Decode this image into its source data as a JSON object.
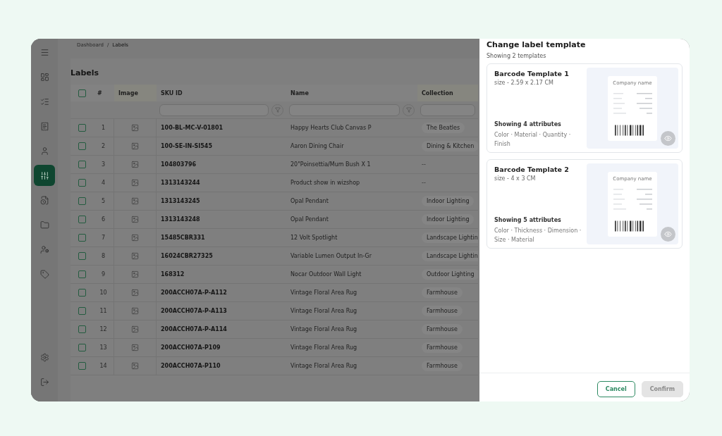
{
  "sidebar": {
    "items": [
      {
        "kind": "menu",
        "selected": false
      },
      {
        "kind": "dashboard",
        "selected": false
      },
      {
        "kind": "list",
        "selected": false
      },
      {
        "kind": "invoice",
        "selected": false
      },
      {
        "kind": "user",
        "selected": false
      },
      {
        "kind": "sliders",
        "selected": true
      },
      {
        "kind": "file",
        "selected": false
      },
      {
        "kind": "folder",
        "selected": false
      },
      {
        "kind": "user-cog",
        "selected": false
      },
      {
        "kind": "tag",
        "selected": false
      }
    ],
    "bottom_items": [
      {
        "kind": "settings",
        "selected": false
      },
      {
        "kind": "logout",
        "selected": false
      }
    ]
  },
  "breadcrumb": {
    "items": [
      "Dashboard",
      "Labels"
    ],
    "separator": "/"
  },
  "page_title": "Labels",
  "table": {
    "select_all": {
      "checked": false
    },
    "columns": [
      {
        "label": "#",
        "filter": false
      },
      {
        "label": "Image",
        "filter": false
      },
      {
        "label": "SKU ID",
        "filter": true
      },
      {
        "label": "Name",
        "filter": true
      },
      {
        "label": "Collection",
        "filter": true
      }
    ],
    "rows": [
      {
        "checked": false,
        "num": "1",
        "sku": "100-BL-MC-V-01801",
        "name": "Happy Hearts Club Canvas P",
        "collection": {
          "kind": "chip",
          "text": "The Beatles"
        }
      },
      {
        "checked": false,
        "num": "2",
        "sku": "100-SE-IN-SI545",
        "name": "Aaron Dining Chair",
        "collection": {
          "kind": "chip",
          "text": "Dining & Kitchen"
        }
      },
      {
        "checked": false,
        "num": "3",
        "sku": "104803796",
        "name": "20\"Poinsettia/Mum Bush X 1",
        "collection": {
          "kind": "empty",
          "text": "--"
        }
      },
      {
        "checked": false,
        "num": "4",
        "sku": "1313143244",
        "name": "Product show in wizshop",
        "collection": {
          "kind": "empty",
          "text": "--"
        }
      },
      {
        "checked": false,
        "num": "5",
        "sku": "1313143245",
        "name": "Opal Pendant",
        "collection": {
          "kind": "chip",
          "text": "Indoor Lighting"
        }
      },
      {
        "checked": false,
        "num": "6",
        "sku": "1313143248",
        "name": "Opal Pendant",
        "collection": {
          "kind": "chip",
          "text": "Indoor Lighting"
        }
      },
      {
        "checked": false,
        "num": "7",
        "sku": "15485CBR331",
        "name": "12 Volt Spotlight",
        "collection": {
          "kind": "chip",
          "text": "Landscape Lightin"
        }
      },
      {
        "checked": false,
        "num": "8",
        "sku": "16024CBR27325",
        "name": "Variable Lumen Output In-Gr",
        "collection": {
          "kind": "chip",
          "text": "Landscape Lightin"
        }
      },
      {
        "checked": false,
        "num": "9",
        "sku": "168312",
        "name": "Nocar Outdoor Wall Light",
        "collection": {
          "kind": "chip",
          "text": "Outdoor Lighting"
        }
      },
      {
        "checked": false,
        "num": "10",
        "sku": "200ACCH07A-P-A112",
        "name": "Vintage Floral Area Rug",
        "collection": {
          "kind": "chip",
          "text": "Farmhouse"
        }
      },
      {
        "checked": false,
        "num": "11",
        "sku": "200ACCH07A-P-A113",
        "name": "Vintage Floral Area Rug",
        "collection": {
          "kind": "chip",
          "text": "Farmhouse"
        }
      },
      {
        "checked": false,
        "num": "12",
        "sku": "200ACCH07A-P-A114",
        "name": "Vintage Floral Area Rug",
        "collection": {
          "kind": "chip",
          "text": "Farmhouse"
        }
      },
      {
        "checked": false,
        "num": "13",
        "sku": "200ACCH07A-P109",
        "name": "Vintage Floral Area Rug",
        "collection": {
          "kind": "chip",
          "text": "Farmhouse"
        }
      },
      {
        "checked": false,
        "num": "14",
        "sku": "200ACCH07A-P110",
        "name": "Vintage Floral Area Rug",
        "collection": {
          "kind": "chip",
          "text": "Farmhouse"
        }
      }
    ]
  },
  "drawer": {
    "title": "Change label template",
    "subtitle": "Showing 2 templates",
    "templates": [
      {
        "title": "Barcode Template 1",
        "size": "size - 2.59 x 2.17 CM",
        "attributes_heading": "Showing 4 attributes",
        "attributes": "Color · Material · Quantity · Finish",
        "preview_company": "Company name"
      },
      {
        "title": "Barcode Template 2",
        "size": "size - 4 x 3 CM",
        "attributes_heading": "Showing 5 attributes",
        "attributes": "Color · Thickness · Dimension · Size · Material",
        "preview_company": "Company name"
      }
    ],
    "buttons": [
      {
        "label": "Cancel",
        "disabled": false
      },
      {
        "label": "Confirm",
        "disabled": true
      }
    ]
  }
}
